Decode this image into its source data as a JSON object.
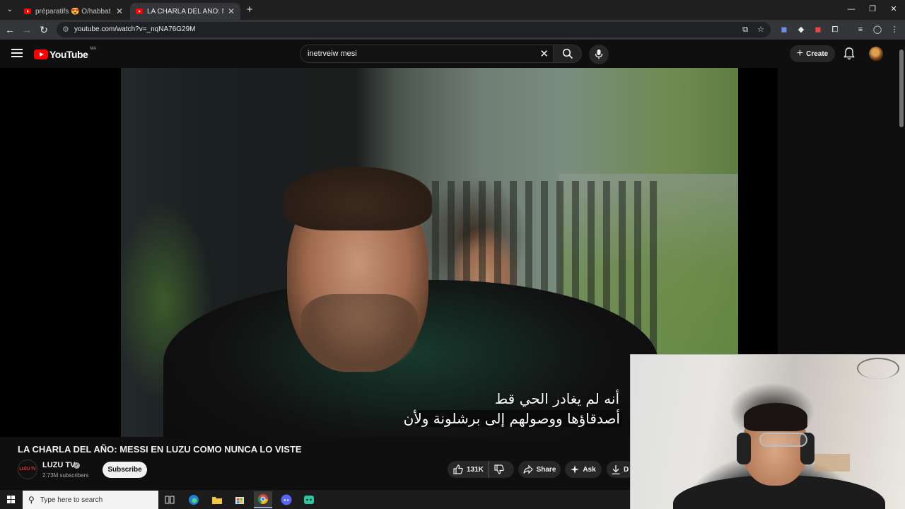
{
  "browser": {
    "tabs": [
      {
        "title": "préparatifs 😍 Ő/habbat abdel",
        "active": false
      },
      {
        "title": "LA CHARLA DEL AÑO: MESSI EN",
        "active": true
      }
    ],
    "url": "youtube.com/watch?v=_nqNA76G29M"
  },
  "youtube": {
    "logo_text": "YouTube",
    "country_code": "MA",
    "search_query": "inetrveiw mesi",
    "create_label": "Create"
  },
  "video": {
    "subtitle_line1": "أنه لم يغادر الحي قط",
    "subtitle_line2": "أصدقاؤها ووصولهم إلى برشلونة ولأن",
    "title": "LA CHARLA DEL AÑO: MESSI EN LUZU COMO NUNCA LO VISTE",
    "channel_name": "LUZU TV",
    "channel_logo_text": "LUZU TV",
    "subscribers": "2.73M subscribers",
    "subscribe_label": "Subscribe",
    "likes": "131K",
    "share_label": "Share",
    "ask_label": "Ask",
    "download_label": "D"
  },
  "taskbar": {
    "search_placeholder": "Type here to search"
  },
  "colors": {
    "youtube_red": "#ff0000",
    "page_bg": "#0f0f0f",
    "chrome_tabstrip": "#1f1f1f",
    "chrome_toolbar": "#35363a"
  }
}
